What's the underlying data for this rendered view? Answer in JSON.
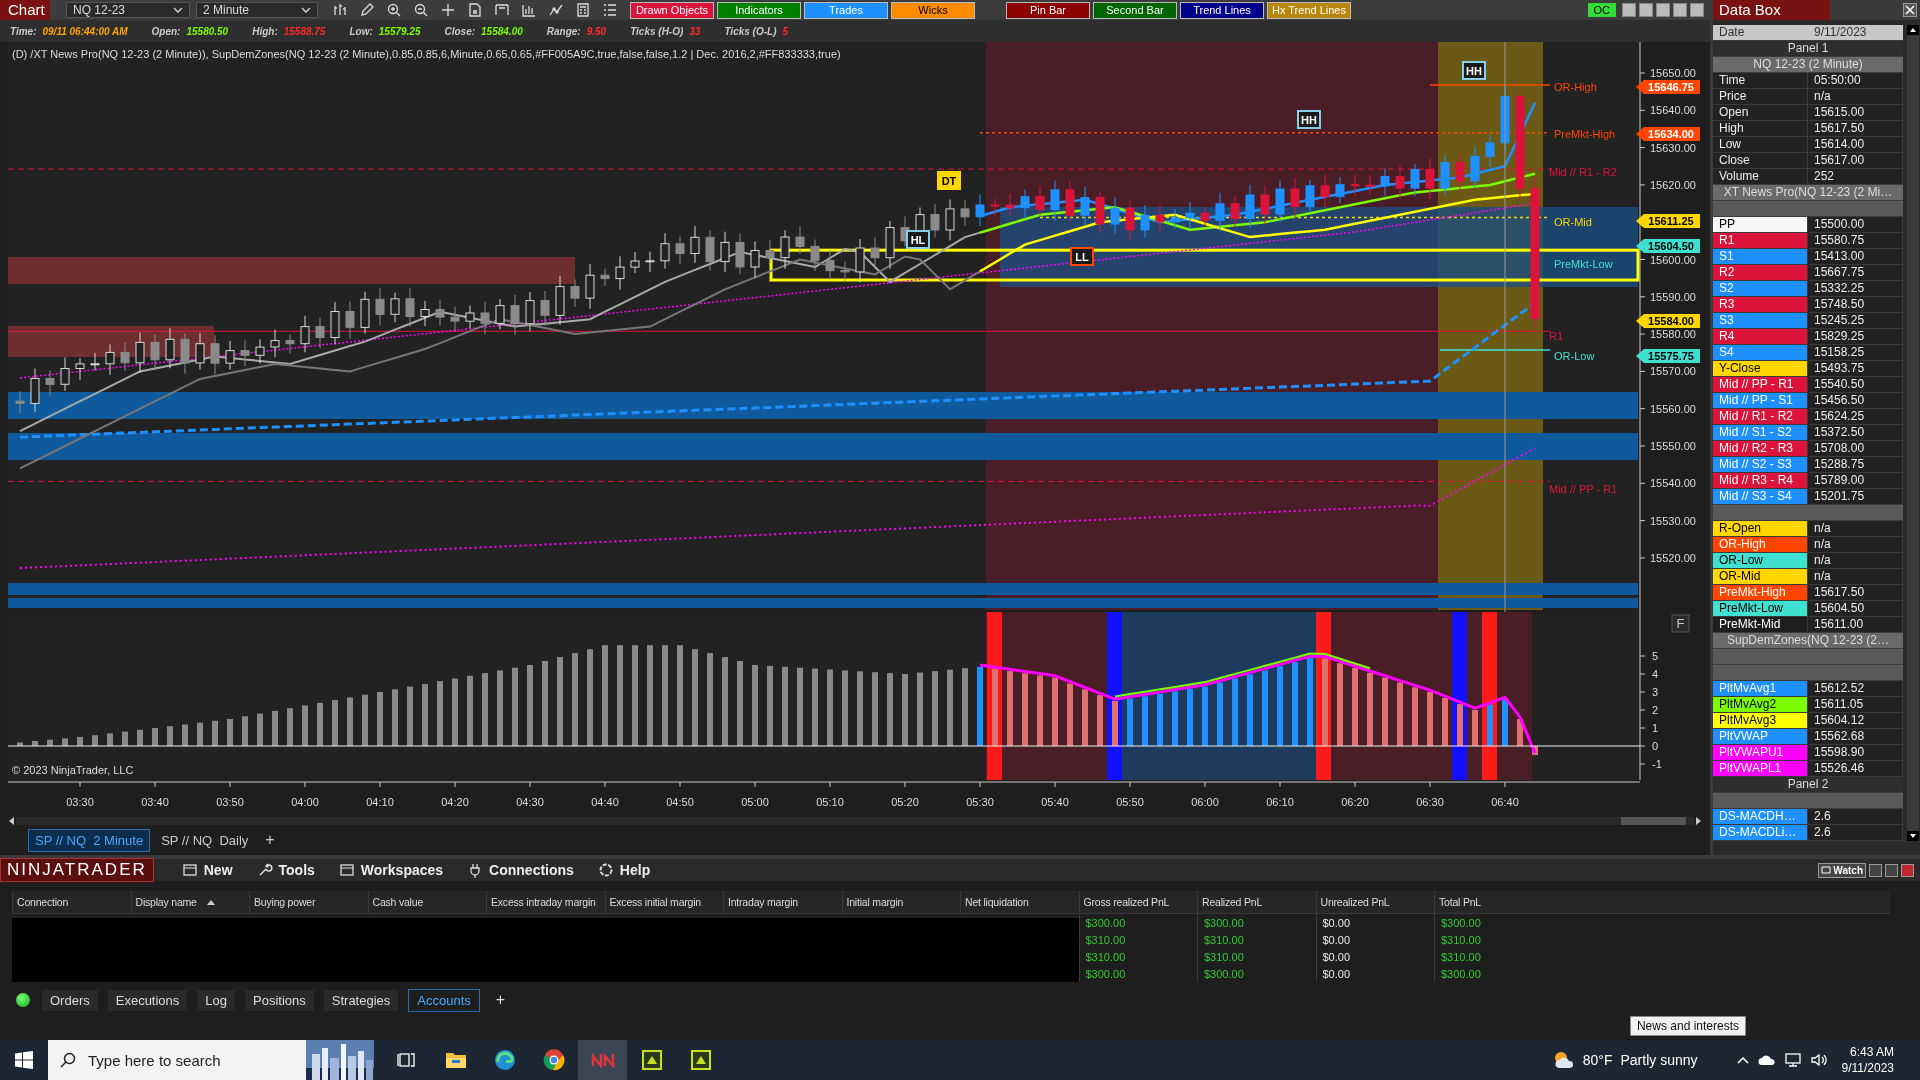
{
  "window": {
    "title": "Chart",
    "instrument": "NQ 12-23",
    "interval": "2 Minute",
    "badge": "OC"
  },
  "toolbar_buttons": [
    {
      "label": "Drawn Objects",
      "color": "#dc143c"
    },
    {
      "label": "Indicators",
      "color": "#008000"
    },
    {
      "label": "Trades",
      "color": "#1e90ff"
    },
    {
      "label": "Wicks",
      "color": "#ff8c00"
    },
    {
      "label": "Pin Bar",
      "color": "#8b0000"
    },
    {
      "label": "Second Bar",
      "color": "#006400"
    },
    {
      "label": "Trend Lines",
      "color": "#00008b"
    },
    {
      "label": "Hx Trend Lines",
      "color": "#b8860b"
    }
  ],
  "info_line": [
    {
      "label": "Time:",
      "value": "09/11 06:44:00 AM",
      "color": "#ffa500"
    },
    {
      "label": "Open:",
      "value": "15580.50",
      "color": "#7cfc00"
    },
    {
      "label": "High:",
      "value": "15588.75",
      "color": "#ff2a2a"
    },
    {
      "label": "Low:",
      "value": "15579.25",
      "color": "#7cfc00"
    },
    {
      "label": "Close:",
      "value": "15584.00",
      "color": "#7cfc00"
    },
    {
      "label": "Range:",
      "value": "9.50",
      "color": "#ff2a2a"
    },
    {
      "label": "Ticks (H-O)",
      "value": "33",
      "color": "#ff2a2a"
    },
    {
      "label": "Ticks (O-L)",
      "value": "5",
      "color": "#ff2a2a"
    }
  ],
  "chart": {
    "caption": "(D) /XT News Pro(NQ 12-23 (2 Minute)), SupDemZones(NQ 12-23 (2 Minute),0.85,0.85,6,Minute,0.65,0.65,#FF005A9C,true,false,false,1.2 | Dec. 2016,2,#FF833333,true)",
    "price_ticks": [
      "15650.00",
      "15640.00",
      "15630.00",
      "15620.00",
      "15600.00",
      "15590.00",
      "15580.00",
      "15570.00",
      "15560.00",
      "15550.00",
      "15540.00",
      "15530.00",
      "15520.00"
    ],
    "time_ticks": [
      "03:30",
      "03:40",
      "03:50",
      "04:00",
      "04:10",
      "04:20",
      "04:30",
      "04:40",
      "04:50",
      "05:00",
      "05:10",
      "05:20",
      "05:30",
      "05:40",
      "05:50",
      "06:00",
      "06:10",
      "06:20",
      "06:30",
      "06:40"
    ],
    "price_tags": [
      {
        "value": "15646.75",
        "color": "#ff4500"
      },
      {
        "value": "15634.00",
        "color": "#ff4500"
      },
      {
        "value": "15611.25",
        "color": "#ffd700"
      },
      {
        "value": "15604.50",
        "color": "#40e0d0"
      },
      {
        "value": "15584.00",
        "color": "#ffd700"
      },
      {
        "value": "15575.75",
        "color": "#40e0d0"
      }
    ],
    "level_labels": [
      {
        "text": "OR-High",
        "color": "#ff4500"
      },
      {
        "text": "PreMkt-High",
        "color": "#ff4500"
      },
      {
        "text": "Mid // R1 - R2",
        "color": "#dc143c"
      },
      {
        "text": "OR-Mid",
        "color": "#ffd700"
      },
      {
        "text": "PreMkt-Low",
        "color": "#40e0d0"
      },
      {
        "text": "R1",
        "color": "#dc143c"
      },
      {
        "text": "OR-Low",
        "color": "#40e0d0"
      },
      {
        "text": "Mid // PP - R1",
        "color": "#dc143c"
      }
    ],
    "pattern_markers": [
      {
        "text": "DT",
        "kind": "filled",
        "color": "#ffd700"
      },
      {
        "text": "HH",
        "kind": "outlined",
        "color": "#87ceeb"
      },
      {
        "text": "HH",
        "kind": "outlined",
        "color": "#87ceeb"
      },
      {
        "text": "HL",
        "kind": "outlined",
        "color": "#87ceeb"
      },
      {
        "text": "LL",
        "kind": "outlined",
        "color": "#ff4500"
      }
    ],
    "oscillator_ticks": [
      "5",
      "4",
      "3",
      "2",
      "1",
      "0",
      "-1"
    ],
    "panel_button": "F",
    "copyright": "© 2023 NinjaTrader, LLC"
  },
  "chart_tabs": [
    {
      "label": "SP // NQ  2 Minute",
      "selected": true
    },
    {
      "label": "SP // NQ  Daily",
      "selected": false
    }
  ],
  "chart_add_tab": "+",
  "data_box": {
    "title": "Data Box",
    "date_label": "Date",
    "date": "9/11/2023",
    "rows": [
      {
        "kind": "header",
        "text": "Panel 1"
      },
      {
        "kind": "subheader",
        "text": "NQ 12-23 (2 Minute)"
      },
      {
        "kind": "value",
        "label": "Time",
        "value": "05:50:00"
      },
      {
        "kind": "value",
        "label": "Price",
        "value": "n/a"
      },
      {
        "kind": "value",
        "label": "Open",
        "value": "15615.00"
      },
      {
        "kind": "value",
        "label": "High",
        "value": "15617.50"
      },
      {
        "kind": "value",
        "label": "Low",
        "value": "15614.00"
      },
      {
        "kind": "value",
        "label": "Close",
        "value": "15617.00"
      },
      {
        "kind": "value",
        "label": "Volume",
        "value": "252"
      },
      {
        "kind": "subheader",
        "text": "XT News Pro(NQ 12-23 (2 Mi…"
      },
      {
        "kind": "spacer"
      },
      {
        "kind": "plot",
        "label": "PP",
        "value": "15500.00",
        "color": "#f5f5f5"
      },
      {
        "kind": "plot",
        "label": "R1",
        "value": "15580.75",
        "color": "#dc143c"
      },
      {
        "kind": "plot",
        "label": "S1",
        "value": "15413.00",
        "color": "#1e90ff"
      },
      {
        "kind": "plot",
        "label": "R2",
        "value": "15667.75",
        "color": "#dc143c"
      },
      {
        "kind": "plot",
        "label": "S2",
        "value": "15332.25",
        "color": "#1e90ff"
      },
      {
        "kind": "plot",
        "label": "R3",
        "value": "15748.50",
        "color": "#dc143c"
      },
      {
        "kind": "plot",
        "label": "S3",
        "value": "15245.25",
        "color": "#1e90ff"
      },
      {
        "kind": "plot",
        "label": "R4",
        "value": "15829.25",
        "color": "#dc143c"
      },
      {
        "kind": "plot",
        "label": "S4",
        "value": "15158.25",
        "color": "#1e90ff"
      },
      {
        "kind": "plot",
        "label": "Y-Close",
        "value": "15493.75",
        "color": "#ffd700"
      },
      {
        "kind": "plot",
        "label": "Mid // PP - R1",
        "value": "15540.50",
        "color": "#dc143c"
      },
      {
        "kind": "plot",
        "label": "Mid // PP - S1",
        "value": "15456.50",
        "color": "#1e90ff"
      },
      {
        "kind": "plot",
        "label": "Mid // R1 - R2",
        "value": "15624.25",
        "color": "#dc143c"
      },
      {
        "kind": "plot",
        "label": "Mid // S1 - S2",
        "value": "15372.50",
        "color": "#1e90ff"
      },
      {
        "kind": "plot",
        "label": "Mid // R2 - R3",
        "value": "15708.00",
        "color": "#dc143c"
      },
      {
        "kind": "plot",
        "label": "Mid // S2 - S3",
        "value": "15288.75",
        "color": "#1e90ff"
      },
      {
        "kind": "plot",
        "label": "Mid // R3 - R4",
        "value": "15789.00",
        "color": "#dc143c"
      },
      {
        "kind": "plot",
        "label": "Mid // S3 - S4",
        "value": "15201.75",
        "color": "#1e90ff"
      },
      {
        "kind": "spacer"
      },
      {
        "kind": "plot",
        "label": "R-Open",
        "value": "n/a",
        "color": "#ffd700"
      },
      {
        "kind": "plot",
        "label": "OR-High",
        "value": "n/a",
        "color": "#ff4500"
      },
      {
        "kind": "plot",
        "label": "OR-Low",
        "value": "n/a",
        "color": "#40e0d0"
      },
      {
        "kind": "plot",
        "label": "OR-Mid",
        "value": "n/a",
        "color": "#ffd700"
      },
      {
        "kind": "plot",
        "label": "PreMkt-High",
        "value": "15617.50",
        "color": "#ff4500"
      },
      {
        "kind": "plot",
        "label": "PreMkt-Low",
        "value": "15604.50",
        "color": "#40e0d0"
      },
      {
        "kind": "plot",
        "label": "PreMkt-Mid",
        "value": "15611.00",
        "color": "#1e1e1e"
      },
      {
        "kind": "subheader",
        "text": "SupDemZones(NQ 12-23 (2…"
      },
      {
        "kind": "spacer"
      },
      {
        "kind": "spacer"
      },
      {
        "kind": "plot",
        "label": "PltMvAvg1",
        "value": "15612.52",
        "color": "#1e90ff"
      },
      {
        "kind": "plot",
        "label": "PltMvAvg2",
        "value": "15611.05",
        "color": "#7cfc00"
      },
      {
        "kind": "plot",
        "label": "PltMvAvg3",
        "value": "15604.12",
        "color": "#ffff00"
      },
      {
        "kind": "plot",
        "label": "PltVWAP",
        "value": "15562.68",
        "color": "#1e90ff"
      },
      {
        "kind": "plot",
        "label": "PltVWAPU1",
        "value": "15598.90",
        "color": "#ff00ff"
      },
      {
        "kind": "plot",
        "label": "PltVWAPL1",
        "value": "15526.46",
        "color": "#ff00ff"
      },
      {
        "kind": "header",
        "text": "Panel 2"
      },
      {
        "kind": "spacer"
      },
      {
        "kind": "plot",
        "label": "DS-MACDH…",
        "value": "2.6",
        "color": "#1e90ff"
      },
      {
        "kind": "plot",
        "label": "DS-MACDLi…",
        "value": "2.6",
        "color": "#1e90ff"
      }
    ]
  },
  "control_center": {
    "brand": "NINJATRADER",
    "menu": [
      "New",
      "Tools",
      "Workspaces",
      "Connections",
      "Help"
    ],
    "watch": "Watch",
    "columns": [
      "Connection",
      "Display name",
      "Buying power",
      "Cash value",
      "Excess intraday margin",
      "Excess initial margin",
      "Intraday margin",
      "Initial margin",
      "Net liquidation",
      "Gross realized PnL",
      "Realized PnL",
      "Unrealized PnL",
      "Total PnL"
    ],
    "rows": [
      {
        "gross_realized_pnl": "$300.00",
        "realized_pnl": "$300.00",
        "unrealized_pnl": "$0.00",
        "total_pnl": "$300.00"
      },
      {
        "gross_realized_pnl": "$310.00",
        "realized_pnl": "$310.00",
        "unrealized_pnl": "$0.00",
        "total_pnl": "$310.00"
      },
      {
        "gross_realized_pnl": "$310.00",
        "realized_pnl": "$310.00",
        "unrealized_pnl": "$0.00",
        "total_pnl": "$310.00"
      },
      {
        "gross_realized_pnl": "$300.00",
        "realized_pnl": "$300.00",
        "unrealized_pnl": "$0.00",
        "total_pnl": "$300.00"
      }
    ],
    "tabs": [
      {
        "label": "Orders",
        "selected": false
      },
      {
        "label": "Executions",
        "selected": false
      },
      {
        "label": "Log",
        "selected": false
      },
      {
        "label": "Positions",
        "selected": false
      },
      {
        "label": "Strategies",
        "selected": false
      },
      {
        "label": "Accounts",
        "selected": true
      }
    ],
    "add_tab": "+"
  },
  "taskbar": {
    "search_placeholder": "Type here to search",
    "tooltip": "News and interests",
    "temperature": "80°F",
    "condition": "Partly sunny",
    "time": "6:43 AM",
    "date": "9/11/2023"
  }
}
